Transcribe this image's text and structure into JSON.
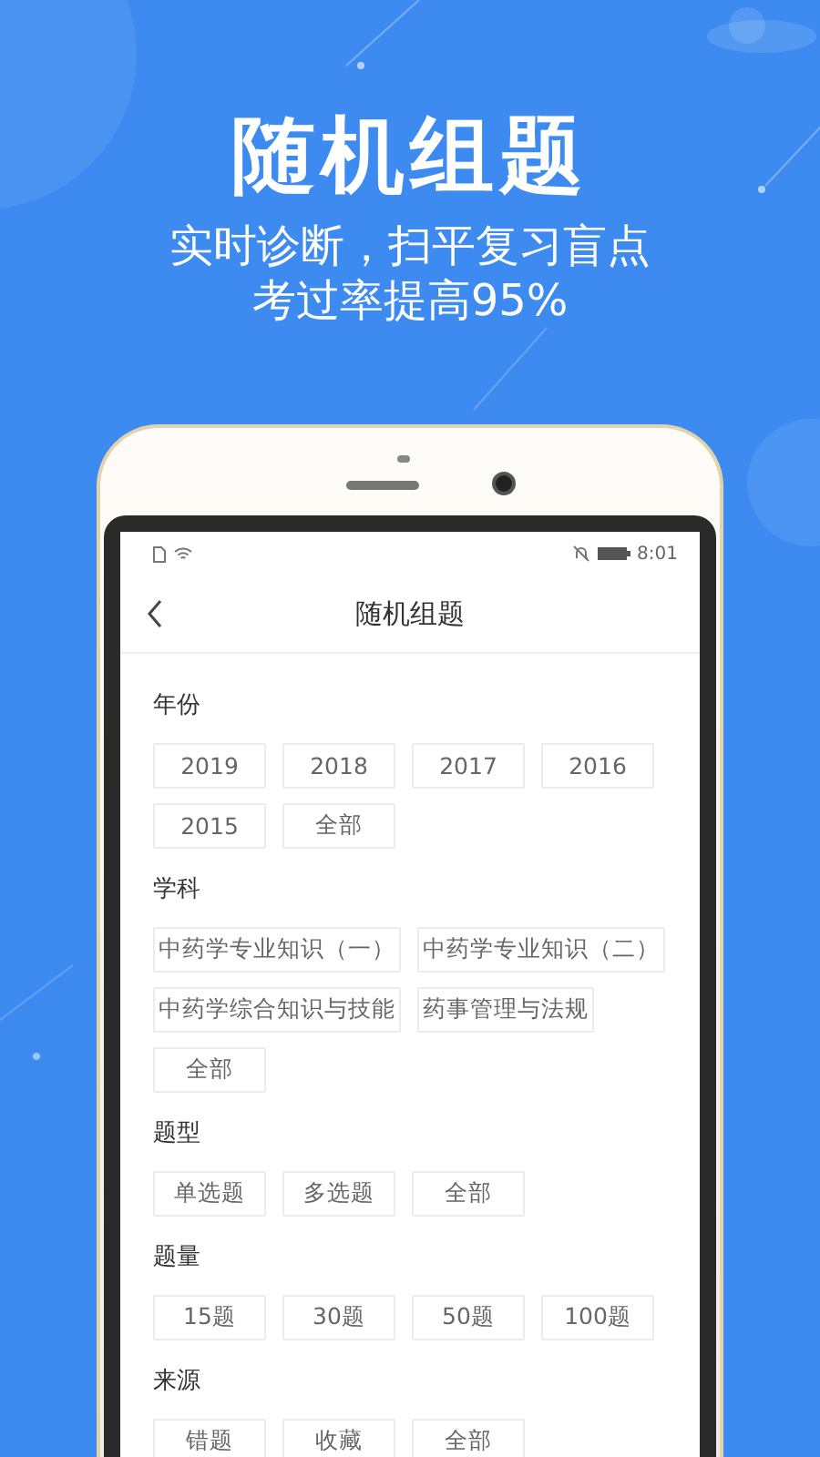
{
  "promo": {
    "title": "随机组题",
    "subtitle_lines": [
      "实时诊断，扫平复习盲点",
      "考过率提高95%"
    ]
  },
  "status_bar": {
    "time": "8:01"
  },
  "nav_bar": {
    "title": "随机组题"
  },
  "sections": [
    {
      "label": "年份",
      "options": [
        "2019",
        "2018",
        "2017",
        "2016",
        "2015",
        "全部"
      ]
    },
    {
      "label": "学科",
      "options": [
        "中药学专业知识（一）",
        "中药学专业知识（二）",
        "中药学综合知识与技能",
        "药事管理与法规",
        "全部"
      ]
    },
    {
      "label": "题型",
      "options": [
        "单选题",
        "多选题",
        "全部"
      ]
    },
    {
      "label": "题量",
      "options": [
        "15题",
        "30题",
        "50题",
        "100题"
      ]
    },
    {
      "label": "来源",
      "options": [
        "错题",
        "收藏",
        "全部"
      ]
    }
  ]
}
